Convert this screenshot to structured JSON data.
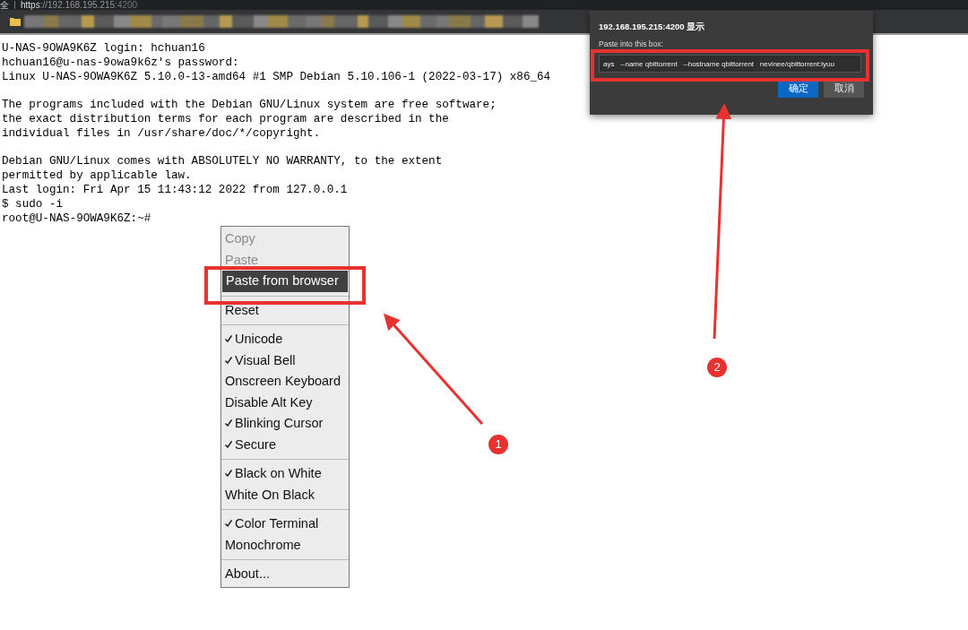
{
  "browser": {
    "tab_fragment": "全",
    "url_scheme": "https",
    "url_host": "://192.168.195.215",
    "url_port": ":4200"
  },
  "terminal": {
    "paragraphs": [
      [
        "U-NAS-9OWA9K6Z login: hchuan16",
        "hchuan16@u-nas-9owa9k6z's password:",
        "Linux U-NAS-9OWA9K6Z 5.10.0-13-amd64 #1 SMP Debian 5.10.106-1 (2022-03-17) x86_64"
      ],
      [
        "The programs included with the Debian GNU/Linux system are free software;",
        "the exact distribution terms for each program are described in the",
        "individual files in /usr/share/doc/*/copyright."
      ],
      [
        "Debian GNU/Linux comes with ABSOLUTELY NO WARRANTY, to the extent",
        "permitted by applicable law.",
        "Last login: Fri Apr 15 11:43:12 2022 from 127.0.0.1",
        "$ sudo -i",
        "root@U-NAS-9OWA9K6Z:~#"
      ]
    ]
  },
  "context_menu": [
    {
      "kind": "item",
      "label": "Copy",
      "disabled": true,
      "selected": false,
      "checked": false
    },
    {
      "kind": "item",
      "label": "Paste",
      "disabled": true,
      "selected": false,
      "checked": false
    },
    {
      "kind": "item",
      "label": "Paste from browser",
      "disabled": false,
      "selected": true,
      "checked": false
    },
    {
      "kind": "separator"
    },
    {
      "kind": "item",
      "label": "Reset",
      "disabled": false,
      "selected": false,
      "checked": false
    },
    {
      "kind": "separator"
    },
    {
      "kind": "item",
      "label": "Unicode",
      "disabled": false,
      "selected": false,
      "checked": true
    },
    {
      "kind": "item",
      "label": "Visual Bell",
      "disabled": false,
      "selected": false,
      "checked": true
    },
    {
      "kind": "item",
      "label": "Onscreen Keyboard",
      "disabled": false,
      "selected": false,
      "checked": false
    },
    {
      "kind": "item",
      "label": "Disable Alt Key",
      "disabled": false,
      "selected": false,
      "checked": false
    },
    {
      "kind": "item",
      "label": "Blinking Cursor",
      "disabled": false,
      "selected": false,
      "checked": true
    },
    {
      "kind": "item",
      "label": "Secure",
      "disabled": false,
      "selected": false,
      "checked": true
    },
    {
      "kind": "separator"
    },
    {
      "kind": "item",
      "label": "Black on White",
      "disabled": false,
      "selected": false,
      "checked": true
    },
    {
      "kind": "item",
      "label": "White On Black",
      "disabled": false,
      "selected": false,
      "checked": false
    },
    {
      "kind": "separator"
    },
    {
      "kind": "item",
      "label": "Color Terminal",
      "disabled": false,
      "selected": false,
      "checked": true
    },
    {
      "kind": "item",
      "label": "Monochrome",
      "disabled": false,
      "selected": false,
      "checked": false
    },
    {
      "kind": "separator"
    },
    {
      "kind": "item",
      "label": "About...",
      "disabled": false,
      "selected": false,
      "checked": false
    }
  ],
  "dialog": {
    "title": "192.168.195.215:4200 显示",
    "label": "Paste into this box:",
    "value": "ays   --name qbittorrent   --hostname qbittorrent   nevinee/qbittorrent:iyuu",
    "buttons": [
      {
        "label": "确定",
        "primary": true
      },
      {
        "label": "取消",
        "primary": false
      }
    ]
  },
  "annotations": [
    {
      "label": "1"
    },
    {
      "label": "2"
    }
  ]
}
